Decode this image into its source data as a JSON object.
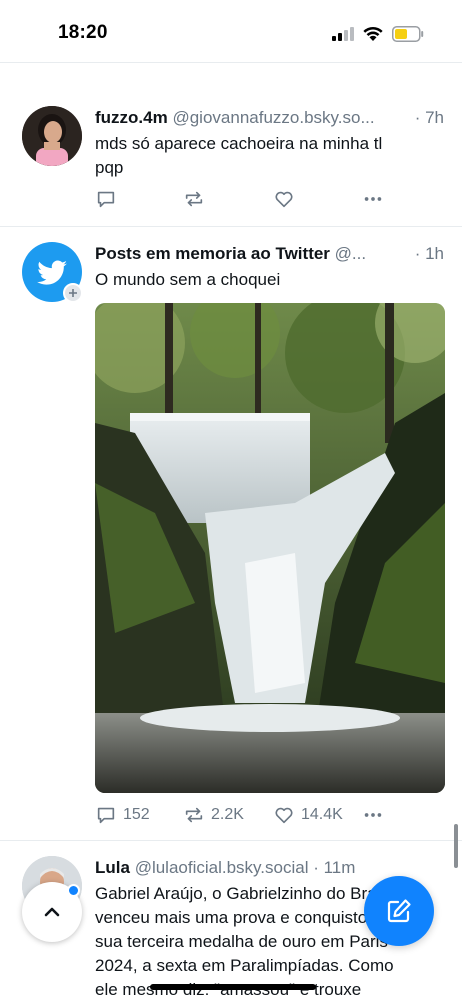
{
  "status_bar": {
    "time": "18:20"
  },
  "posts": [
    {
      "display_name": "fuzzo.4m",
      "handle": "@giovannafuzzo.bsky.so...",
      "time": "· 7h",
      "text_lines": [
        "mds só aparece cachoeira na minha tl",
        "pqp"
      ],
      "replies": "",
      "reposts": "",
      "likes": ""
    },
    {
      "display_name": "Posts em memoria ao Twitter",
      "handle": "@...",
      "time": "· 1h",
      "text_lines": [
        "O mundo sem a choquei"
      ],
      "replies": "152",
      "reposts": "2.2K",
      "likes": "14.4K"
    },
    {
      "display_name": "Lula",
      "handle": "@lulaoficial.bsky.social",
      "time": "· 11m",
      "text_lines": [
        "Gabriel Araújo, o Gabrielzinho do Brasil,",
        "venceu mais uma prova e conquistou",
        "sua terceira medalha de ouro em Paris",
        "2024, a sexta em Paralimpíadas. Como",
        "ele mesmo diz: \"amassou\" e trouxe"
      ]
    }
  ],
  "colors": {
    "accent": "#1083fe",
    "muted": "#6b7784",
    "text": "#0f1419"
  },
  "icons": [
    "reply-icon",
    "repost-icon",
    "like-icon",
    "more-icon",
    "compose-icon",
    "chevron-up-icon"
  ]
}
